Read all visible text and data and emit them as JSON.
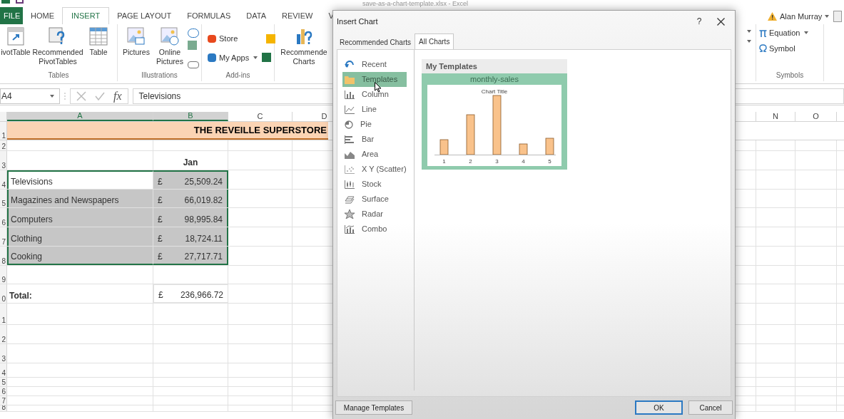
{
  "window": {
    "title": "save-as-a-chart-template.xlsx - Excel",
    "user": "Alan Murray"
  },
  "tabs": [
    {
      "label": "FILE",
      "kind": "file",
      "selected": false
    },
    {
      "label": "HOME",
      "kind": "tab",
      "selected": false
    },
    {
      "label": "INSERT",
      "kind": "tab",
      "selected": true
    },
    {
      "label": "PAGE LAYOUT",
      "kind": "tab",
      "selected": false
    },
    {
      "label": "FORMULAS",
      "kind": "tab",
      "selected": false
    },
    {
      "label": "DATA",
      "kind": "tab",
      "selected": false
    },
    {
      "label": "REVIEW",
      "kind": "tab",
      "selected": false
    },
    {
      "label": "V",
      "kind": "tab",
      "selected": false
    }
  ],
  "ribbon": {
    "groups": [
      {
        "label": "Tables",
        "items": [
          "ivotTable",
          "Recommended PivotTables",
          "Table"
        ]
      },
      {
        "label": "Illustrations",
        "items": [
          "Pictures",
          "Online Pictures"
        ]
      },
      {
        "label": "Add-ins",
        "items": [
          "Store",
          "My Apps"
        ]
      },
      {
        "items": [
          "Recommende Charts"
        ]
      },
      {
        "label": "Symbols",
        "items": [
          "Equation",
          "Symbol"
        ]
      }
    ]
  },
  "formula_bar": {
    "name_box": "A4",
    "function_label": "fx",
    "value": "Televisions"
  },
  "sheet": {
    "columns": [
      {
        "label": "A",
        "selected": true
      },
      {
        "label": "B",
        "selected": true
      },
      {
        "label": "C",
        "selected": false
      },
      {
        "label": "D",
        "selected": false
      },
      {
        "label": "N",
        "selected": false
      },
      {
        "label": "O",
        "selected": false
      }
    ],
    "rows": [
      {
        "number": "1",
        "kind": "title",
        "text": "THE REVEILLE SUPERSTORE"
      },
      {
        "number": "2",
        "kind": "blank"
      },
      {
        "number": "3",
        "kind": "header",
        "text": "Jan"
      },
      {
        "number": "4",
        "kind": "item",
        "label": "Televisions",
        "currency": "£",
        "value": "25,509.24",
        "selected": true,
        "active": true
      },
      {
        "number": "5",
        "kind": "item",
        "label": "Magazines and Newspapers",
        "currency": "£",
        "value": "66,019.82",
        "selected": true,
        "active": false
      },
      {
        "number": "6",
        "kind": "item",
        "label": "Computers",
        "currency": "£",
        "value": "98,995.84",
        "selected": true,
        "active": false
      },
      {
        "number": "7",
        "kind": "item",
        "label": "Clothing",
        "currency": "£",
        "value": "18,724.11",
        "selected": true,
        "active": false
      },
      {
        "number": "8",
        "kind": "item",
        "label": "Cooking",
        "currency": "£",
        "value": "27,717.71",
        "selected": true,
        "active": false
      },
      {
        "number": "9",
        "kind": "blank"
      },
      {
        "number": "0",
        "kind": "total",
        "label": "Total:",
        "currency": "£",
        "value": "236,966.72"
      },
      {
        "number": "1",
        "kind": "blank"
      },
      {
        "number": "2",
        "kind": "blank"
      },
      {
        "number": "3",
        "kind": "blank"
      },
      {
        "number": "4",
        "kind": "blank"
      },
      {
        "number": "5",
        "kind": "blank"
      },
      {
        "number": "6",
        "kind": "blank"
      },
      {
        "number": "7",
        "kind": "blank"
      },
      {
        "number": "8",
        "kind": "blank"
      }
    ]
  },
  "dialog": {
    "title": "Insert Chart",
    "help": "?",
    "tabs": [
      {
        "label": "Recommended Charts",
        "selected": false
      },
      {
        "label": "All Charts",
        "selected": true
      }
    ],
    "chart_types": [
      {
        "label": "Recent",
        "selected": false
      },
      {
        "label": "Templates",
        "selected": true
      },
      {
        "label": "Column",
        "selected": false
      },
      {
        "label": "Line",
        "selected": false
      },
      {
        "label": "Pie",
        "selected": false
      },
      {
        "label": "Bar",
        "selected": false
      },
      {
        "label": "Area",
        "selected": false
      },
      {
        "label": "X Y (Scatter)",
        "selected": false
      },
      {
        "label": "Stock",
        "selected": false
      },
      {
        "label": "Surface",
        "selected": false
      },
      {
        "label": "Radar",
        "selected": false
      },
      {
        "label": "Combo",
        "selected": false
      }
    ],
    "section_title": "My Templates",
    "templates": [
      {
        "name": "monthly-sales",
        "chart_title": "Chart Title",
        "x_labels": [
          "1",
          "2",
          "3",
          "4",
          "5"
        ]
      }
    ],
    "buttons": [
      {
        "label": "Manage Templates",
        "kind": "manage"
      },
      {
        "label": "OK",
        "kind": "default"
      },
      {
        "label": "Cancel",
        "kind": "normal"
      }
    ]
  }
}
